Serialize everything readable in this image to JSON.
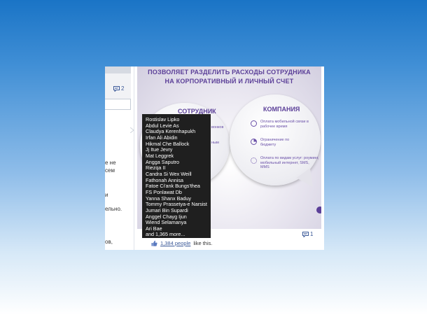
{
  "left_column": {
    "comment_count": "2",
    "text_lines": [
      "е не",
      "сем",
      "и",
      "ельно.",
      "ов,"
    ]
  },
  "post": {
    "header_line1": "ПОЗВОЛЯЕТ РАЗДЕЛИТЬ РАСХОДЫ СОТРУДНИКА",
    "header_line2": "НА КОРПОРАТИВНЫЙ И ЛИЧНЫЙ СЧЕТ",
    "left_bubble_title": "СОТРУДНИК",
    "left_bubble_items": [
      "вонков",
      "ным"
    ],
    "right_bubble_title": "КОМПАНИЯ",
    "right_bubble_items": [
      "Оплата мобильной связи в рабочее время",
      "Ограничение по бюджету",
      "Оплата по видам услуг: роуминг, мобильный интернет, SMS, MMS"
    ],
    "comment_count": "1",
    "likes_link": "1,384 people",
    "likes_suffix": "like this.",
    "dots": "...."
  },
  "tooltip": {
    "names": [
      "Rostislav Lipko",
      "Abdul Levie As",
      "Claudya Kerenhapukh",
      "Irfan Ali Abidin",
      "Hikmal Che Ballock",
      "Jj Itue Jevry",
      "Mat Leggrek",
      "Angga Saputro",
      "Riezqa II",
      "Candra Si Wex Weill",
      "Fathonah Annisa",
      "Fatoe Ci'ank Bungs'thea",
      "FS Ponlawat Db",
      "Yanna Shanx Baduy",
      "Tommy Prassetya-e Narsist",
      "Jumari Bin Supardi",
      "Anggel Chayg Ijun",
      "Wiend Selamanya",
      "Ari Bae",
      "and 1,365 more..."
    ]
  },
  "icons": {
    "comment": "comment-bubble-icon",
    "like": "thumbs-up-icon"
  },
  "colors": {
    "link": "#3b5998",
    "infographic_purple": "#5b3f98",
    "tooltip_bg": "#1f1f1f"
  }
}
